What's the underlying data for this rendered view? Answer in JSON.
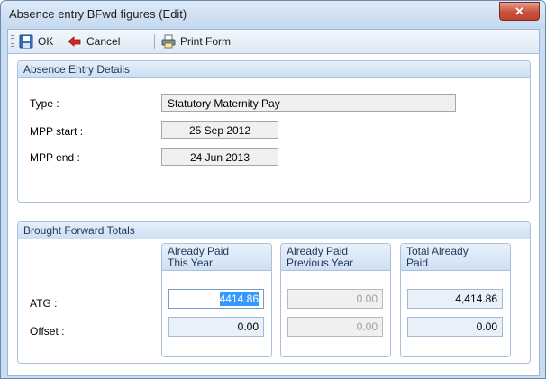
{
  "window": {
    "title": "Absence entry BFwd figures (Edit)",
    "close_label": "✕"
  },
  "toolbar": {
    "ok_label": "OK",
    "cancel_label": "Cancel",
    "print_label": "Print Form"
  },
  "details": {
    "header": "Absence Entry Details",
    "type_label": "Type :",
    "type_value": "Statutory Maternity Pay",
    "start_label": "MPP start :",
    "start_value": "25 Sep 2012",
    "end_label": "MPP end :",
    "end_value": "24 Jun 2013"
  },
  "totals": {
    "header": "Brought Forward Totals",
    "atg_label": "ATG :",
    "offset_label": "Offset :",
    "columns": [
      {
        "line1": "Already Paid",
        "line2": "This Year",
        "atg": "4414.86",
        "offset": "0.00"
      },
      {
        "line1": "Already Paid",
        "line2": "Previous Year",
        "atg": "0.00",
        "offset": "0.00"
      },
      {
        "line1": "Total Already",
        "line2": "Paid",
        "atg": "4,414.86",
        "offset": "0.00"
      }
    ]
  }
}
